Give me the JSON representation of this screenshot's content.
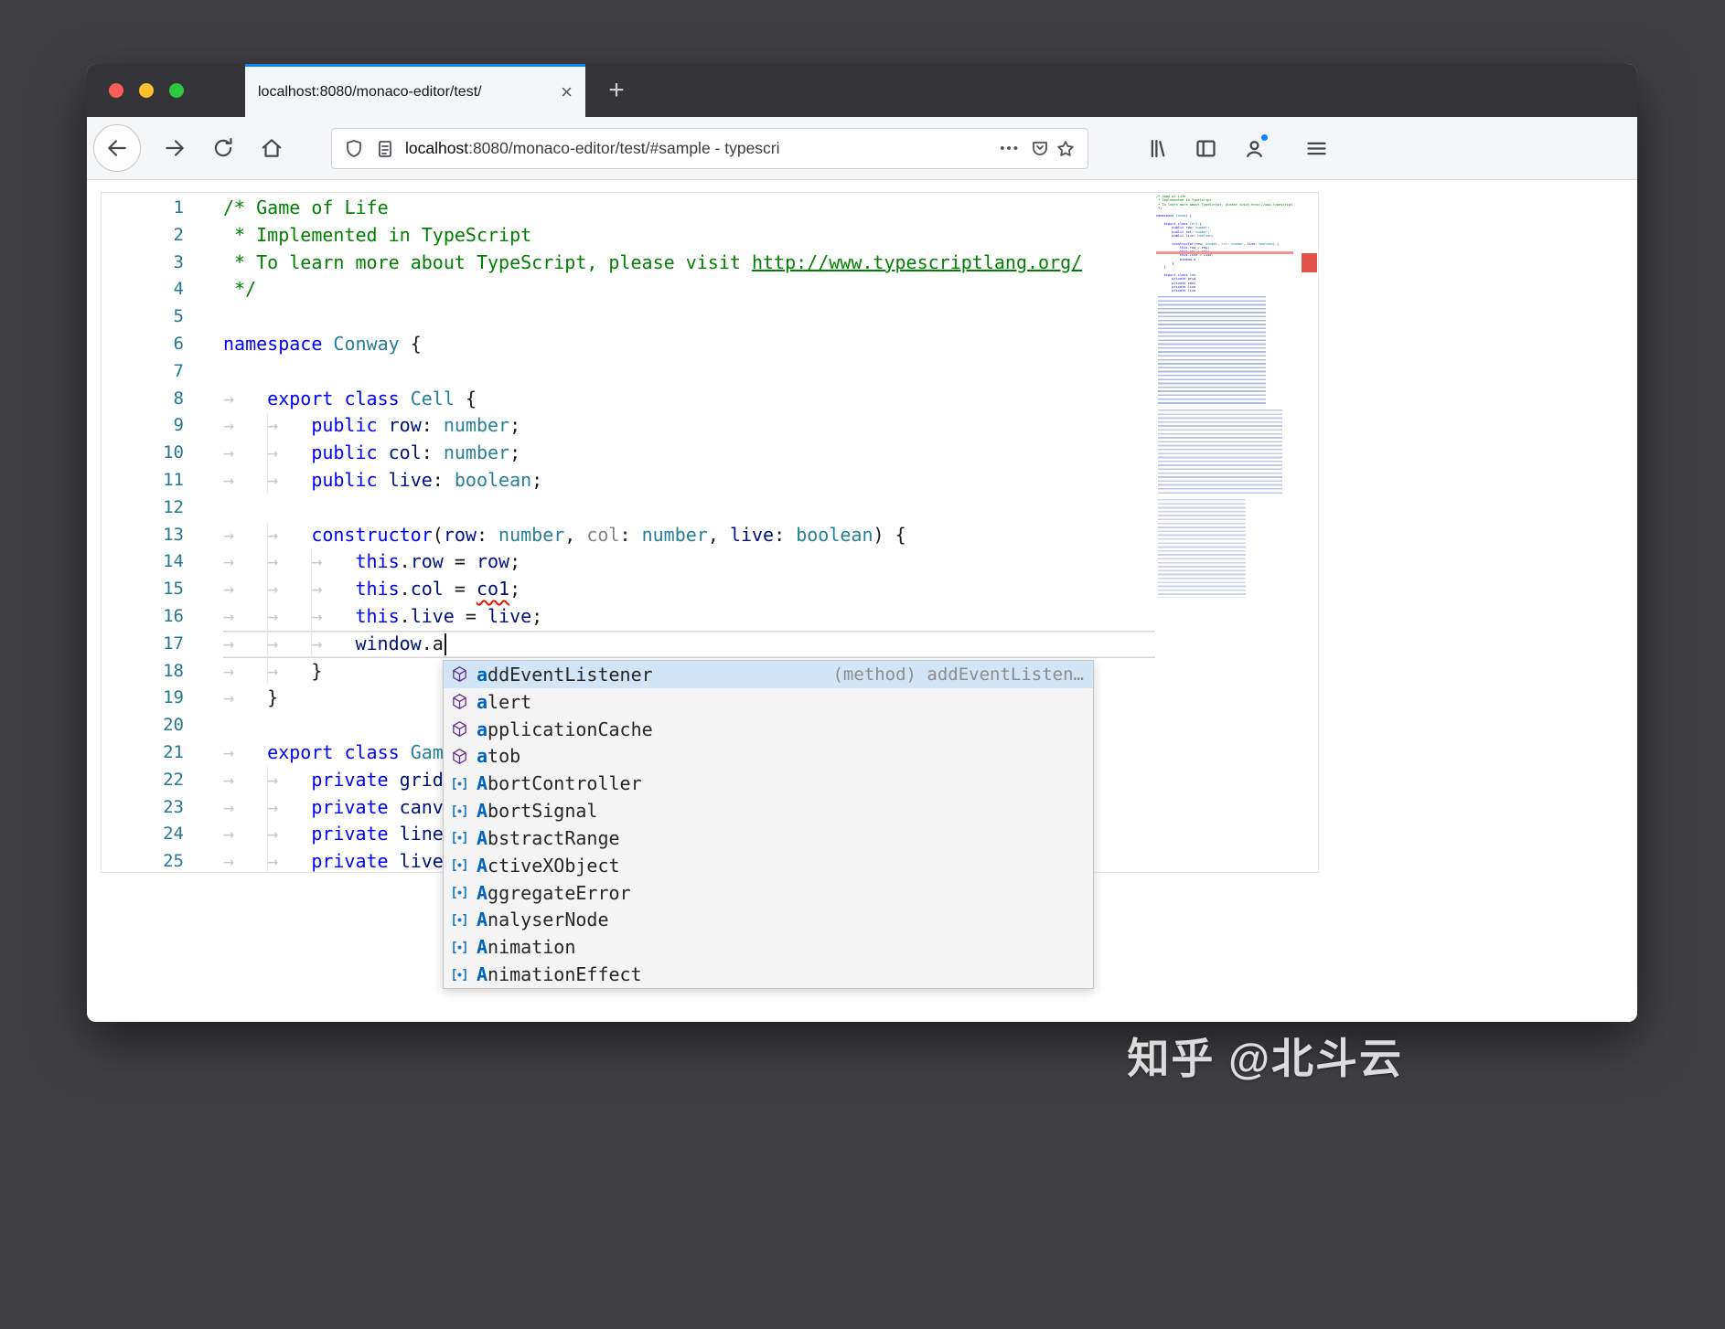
{
  "browser": {
    "tab_title": "localhost:8080/monaco-editor/test/",
    "tab_close_glyph": "×",
    "new_tab_glyph": "+",
    "url_host": "localhost",
    "url_rest": ":8080/monaco-editor/test/#sample - typescri",
    "page_actions_glyph": "•••"
  },
  "editor": {
    "tab_glyph": "→",
    "lines": [
      {
        "num": 1,
        "indent": 0,
        "tokens": [
          {
            "t": "/* Game of Life",
            "c": "cmt"
          }
        ]
      },
      {
        "num": 2,
        "indent": 0,
        "tokens": [
          {
            "t": " * Implemented in TypeScript",
            "c": "cmt"
          }
        ]
      },
      {
        "num": 3,
        "indent": 0,
        "tokens": [
          {
            "t": " * To learn more about TypeScript, please visit ",
            "c": "cmt"
          },
          {
            "t": "http://www.typescriptlang.org/",
            "c": "cmt-link"
          }
        ]
      },
      {
        "num": 4,
        "indent": 0,
        "tokens": [
          {
            "t": " */",
            "c": "cmt"
          }
        ]
      },
      {
        "num": 5,
        "indent": 0,
        "tokens": []
      },
      {
        "num": 6,
        "indent": 0,
        "tokens": [
          {
            "t": "namespace",
            "c": "kw"
          },
          {
            "t": " "
          },
          {
            "t": "Conway",
            "c": "type"
          },
          {
            "t": " {"
          }
        ]
      },
      {
        "num": 7,
        "indent": 0,
        "tokens": []
      },
      {
        "num": 8,
        "indent": 1,
        "tokens": [
          {
            "t": "export",
            "c": "kw"
          },
          {
            "t": " "
          },
          {
            "t": "class",
            "c": "kw"
          },
          {
            "t": " "
          },
          {
            "t": "Cell",
            "c": "type"
          },
          {
            "t": " {"
          }
        ]
      },
      {
        "num": 9,
        "indent": 2,
        "tokens": [
          {
            "t": "public",
            "c": "kw"
          },
          {
            "t": " "
          },
          {
            "t": "row",
            "c": "var"
          },
          {
            "t": ": "
          },
          {
            "t": "number",
            "c": "type"
          },
          {
            "t": ";"
          }
        ]
      },
      {
        "num": 10,
        "indent": 2,
        "tokens": [
          {
            "t": "public",
            "c": "kw"
          },
          {
            "t": " "
          },
          {
            "t": "col",
            "c": "var"
          },
          {
            "t": ": "
          },
          {
            "t": "number",
            "c": "type"
          },
          {
            "t": ";"
          }
        ]
      },
      {
        "num": 11,
        "indent": 2,
        "tokens": [
          {
            "t": "public",
            "c": "kw"
          },
          {
            "t": " "
          },
          {
            "t": "live",
            "c": "var"
          },
          {
            "t": ": "
          },
          {
            "t": "boolean",
            "c": "type"
          },
          {
            "t": ";"
          }
        ]
      },
      {
        "num": 12,
        "indent": 0,
        "tokens": []
      },
      {
        "num": 13,
        "indent": 2,
        "tokens": [
          {
            "t": "constructor",
            "c": "kw"
          },
          {
            "t": "("
          },
          {
            "t": "row",
            "c": "var"
          },
          {
            "t": ": "
          },
          {
            "t": "number",
            "c": "type"
          },
          {
            "t": ", "
          },
          {
            "t": "col",
            "c": "unused"
          },
          {
            "t": ": "
          },
          {
            "t": "number",
            "c": "type"
          },
          {
            "t": ", "
          },
          {
            "t": "live",
            "c": "var"
          },
          {
            "t": ": "
          },
          {
            "t": "boolean",
            "c": "type"
          },
          {
            "t": ") {"
          }
        ]
      },
      {
        "num": 14,
        "indent": 3,
        "tokens": [
          {
            "t": "this",
            "c": "kw"
          },
          {
            "t": "."
          },
          {
            "t": "row",
            "c": "var"
          },
          {
            "t": " = "
          },
          {
            "t": "row",
            "c": "var"
          },
          {
            "t": ";"
          }
        ]
      },
      {
        "num": 15,
        "indent": 3,
        "tokens": [
          {
            "t": "this",
            "c": "kw"
          },
          {
            "t": "."
          },
          {
            "t": "col",
            "c": "var"
          },
          {
            "t": " = "
          },
          {
            "t": "co1",
            "c": "err"
          },
          {
            "t": ";"
          }
        ]
      },
      {
        "num": 16,
        "indent": 3,
        "tokens": [
          {
            "t": "this",
            "c": "kw"
          },
          {
            "t": "."
          },
          {
            "t": "live",
            "c": "var"
          },
          {
            "t": " = "
          },
          {
            "t": "live",
            "c": "var"
          },
          {
            "t": ";"
          }
        ]
      },
      {
        "num": 17,
        "indent": 3,
        "current": true,
        "cursor": true,
        "tokens": [
          {
            "t": "window",
            "c": "var"
          },
          {
            "t": ".a"
          }
        ]
      },
      {
        "num": 18,
        "indent": 2,
        "tokens": [
          {
            "t": "}"
          }
        ]
      },
      {
        "num": 19,
        "indent": 1,
        "tokens": [
          {
            "t": "}"
          }
        ]
      },
      {
        "num": 20,
        "indent": 0,
        "tokens": []
      },
      {
        "num": 21,
        "indent": 1,
        "tokens": [
          {
            "t": "export",
            "c": "kw"
          },
          {
            "t": " "
          },
          {
            "t": "class",
            "c": "kw"
          },
          {
            "t": " "
          },
          {
            "t": "Gam",
            "c": "type"
          }
        ]
      },
      {
        "num": 22,
        "indent": 2,
        "tokens": [
          {
            "t": "private",
            "c": "kw"
          },
          {
            "t": " "
          },
          {
            "t": "grid",
            "c": "var"
          }
        ]
      },
      {
        "num": 23,
        "indent": 2,
        "tokens": [
          {
            "t": "private",
            "c": "kw"
          },
          {
            "t": " "
          },
          {
            "t": "canv",
            "c": "var"
          }
        ]
      },
      {
        "num": 24,
        "indent": 2,
        "tokens": [
          {
            "t": "private",
            "c": "kw"
          },
          {
            "t": " "
          },
          {
            "t": "line",
            "c": "var"
          }
        ]
      },
      {
        "num": 25,
        "indent": 2,
        "tokens": [
          {
            "t": "private",
            "c": "kw"
          },
          {
            "t": " "
          },
          {
            "t": "live",
            "c": "var"
          }
        ]
      }
    ]
  },
  "suggest": {
    "items": [
      {
        "label": "addEventListener",
        "kind": "method",
        "selected": true,
        "detail": "(method) addEventListen…"
      },
      {
        "label": "alert",
        "kind": "method"
      },
      {
        "label": "applicationCache",
        "kind": "method"
      },
      {
        "label": "atob",
        "kind": "method"
      },
      {
        "label": "AbortController",
        "kind": "variable"
      },
      {
        "label": "AbortSignal",
        "kind": "variable"
      },
      {
        "label": "AbstractRange",
        "kind": "variable"
      },
      {
        "label": "ActiveXObject",
        "kind": "variable"
      },
      {
        "label": "AggregateError",
        "kind": "variable"
      },
      {
        "label": "AnalyserNode",
        "kind": "variable"
      },
      {
        "label": "Animation",
        "kind": "variable"
      },
      {
        "label": "AnimationEffect",
        "kind": "variable"
      }
    ]
  },
  "watermark": "知乎 @北斗云",
  "colors": {
    "accent_blue": "#0a84ff",
    "error_red": "#e51400",
    "comment_green": "#008000",
    "keyword_blue": "#0000ff",
    "type_teal": "#267f99",
    "variable_navy": "#001080",
    "method_purple": "#652d90",
    "symbol_blue": "#1979c9",
    "suggest_selected": "#d2e5f7"
  }
}
